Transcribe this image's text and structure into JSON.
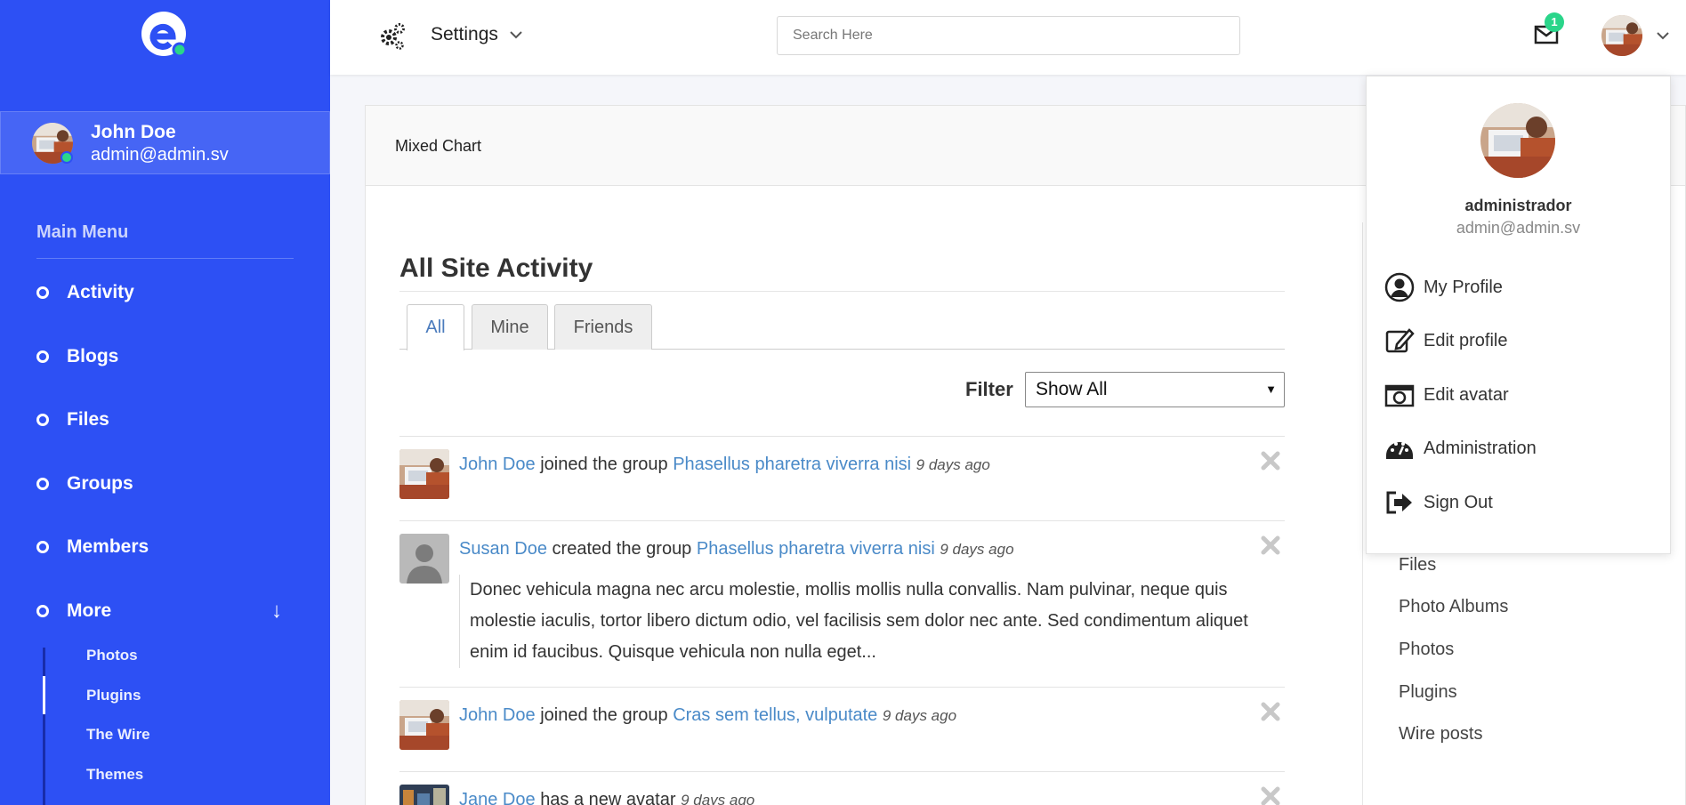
{
  "sidebar": {
    "user": {
      "name": "John Doe",
      "email": "admin@admin.sv"
    },
    "menu_title": "Main Menu",
    "items": [
      {
        "label": "Activity"
      },
      {
        "label": "Blogs"
      },
      {
        "label": "Files"
      },
      {
        "label": "Groups"
      },
      {
        "label": "Members"
      },
      {
        "label": "More"
      }
    ],
    "more_arrow": "↓",
    "submenu": [
      {
        "label": "Photos"
      },
      {
        "label": "Plugins"
      },
      {
        "label": "The Wire"
      },
      {
        "label": "Themes"
      }
    ]
  },
  "topbar": {
    "settings_label": "Settings",
    "search_placeholder": "Search Here",
    "mail_count": "1"
  },
  "card": {
    "title": "Mixed Chart"
  },
  "activity": {
    "title": "All Site Activity",
    "tabs": [
      {
        "label": "All"
      },
      {
        "label": "Mine"
      },
      {
        "label": "Friends"
      }
    ],
    "filter_label": "Filter",
    "filter_value": "Show All",
    "items": [
      {
        "user": "John Doe",
        "action": "joined the group",
        "target": "Phasellus pharetra viverra nisi",
        "time": "9 days ago"
      },
      {
        "user": "Susan Doe",
        "action": "created the group",
        "target": "Phasellus pharetra viverra nisi",
        "time": "9 days ago",
        "excerpt": "Donec vehicula magna nec arcu molestie, mollis mollis nulla convallis. Nam pulvinar, neque quis molestie iaculis, tortor libero dictum odio, vel facilisis sem dolor nec ante. Sed condimentum aliquet enim id faucibus. Quisque vehicula non nulla eget..."
      },
      {
        "user": "John Doe",
        "action": "joined the group",
        "target": "Cras sem tellus, vulputate",
        "time": "9 days ago"
      },
      {
        "user": "Jane Doe",
        "action": "has a new avatar",
        "time": "9 days ago"
      }
    ]
  },
  "right_links": [
    "Files",
    "Photo Albums",
    "Photos",
    "Plugins",
    "Wire posts"
  ],
  "dropdown": {
    "name": "administrador",
    "email": "admin@admin.sv",
    "items": [
      {
        "label": "My Profile",
        "icon": "user-circle-icon"
      },
      {
        "label": "Edit profile",
        "icon": "edit-icon"
      },
      {
        "label": "Edit avatar",
        "icon": "camera-icon"
      },
      {
        "label": "Administration",
        "icon": "dashboard-icon"
      },
      {
        "label": "Sign Out",
        "icon": "sign-out-icon"
      }
    ]
  },
  "colors": {
    "sidebar": "#2d50f4",
    "accent_green": "#2ad58a",
    "link": "#4a8ac8"
  }
}
